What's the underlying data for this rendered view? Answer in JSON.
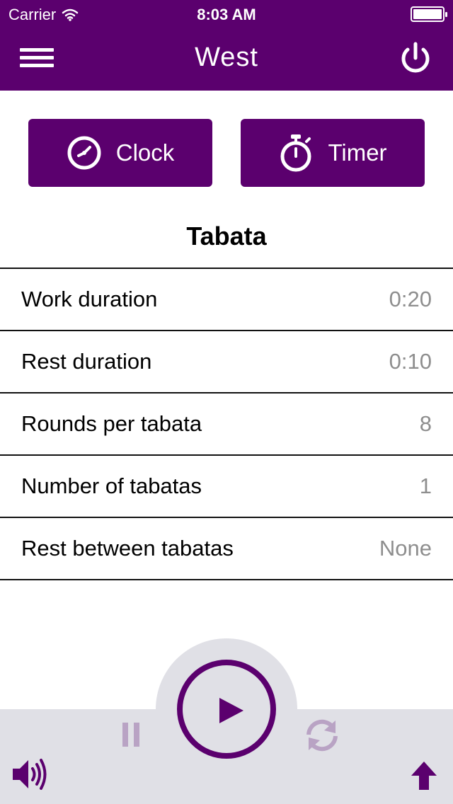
{
  "status": {
    "carrier": "Carrier",
    "time": "8:03 AM",
    "battery_level": 1.0
  },
  "nav": {
    "title": "West",
    "icons": {
      "menu": "hamburger-menu-icon",
      "power": "power-icon"
    }
  },
  "modes": {
    "clock": {
      "label": "Clock",
      "icon": "clock-icon"
    },
    "timer": {
      "label": "Timer",
      "icon": "stopwatch-icon"
    }
  },
  "section_title": "Tabata",
  "settings": [
    {
      "label": "Work duration",
      "value": "0:20"
    },
    {
      "label": "Rest duration",
      "value": "0:10"
    },
    {
      "label": "Rounds per tabata",
      "value": "8"
    },
    {
      "label": "Number of tabatas",
      "value": "1"
    },
    {
      "label": "Rest between tabatas",
      "value": "None"
    }
  ],
  "controls": {
    "icons": [
      "play-icon",
      "pause-icon",
      "refresh-icon",
      "volume-icon",
      "upload-arrow-icon"
    ]
  },
  "colors": {
    "brand": "#5b006e",
    "bar": "#e0e0e6",
    "muted_value": "#8e8e8e",
    "disabled_icon": "#b9a3c4"
  }
}
